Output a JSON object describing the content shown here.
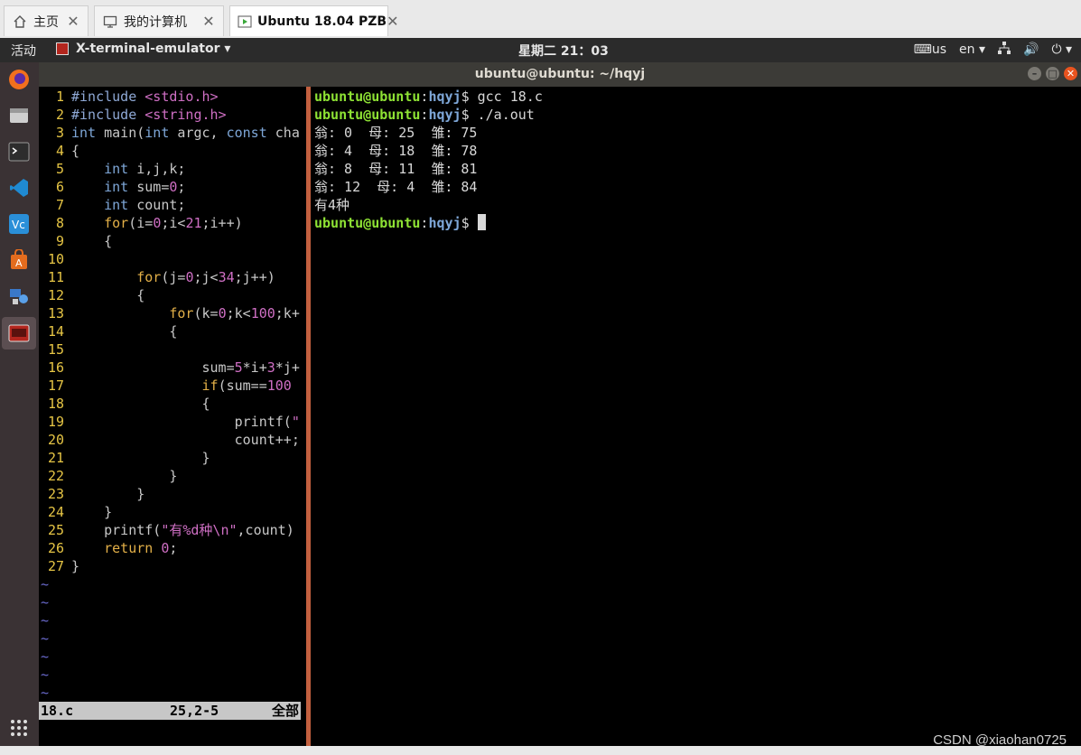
{
  "vm_tabs": [
    {
      "label": "主页",
      "icon": "home-icon"
    },
    {
      "label": "我的计算机",
      "icon": "computer-icon"
    },
    {
      "label": "Ubuntu 18.04 PZB",
      "icon": "vm-play-icon"
    }
  ],
  "topbar": {
    "activities": "活动",
    "app_menu": "X-terminal-emulator ▾",
    "clock": "星期二 21：03",
    "keyboard": "us",
    "language": "en ▾"
  },
  "window": {
    "title": "ubuntu@ubuntu: ~/hqyj"
  },
  "vim": {
    "lines": [
      {
        "n": "1",
        "text": "#include <stdio.h>"
      },
      {
        "n": "2",
        "text": "#include <string.h>"
      },
      {
        "n": "3",
        "text": "int main(int argc, const cha"
      },
      {
        "n": "4",
        "text": "{"
      },
      {
        "n": "5",
        "text": "    int i,j,k;"
      },
      {
        "n": "6",
        "text": "    int sum=0;"
      },
      {
        "n": "7",
        "text": "    int count;"
      },
      {
        "n": "8",
        "text": "    for(i=0;i<21;i++)"
      },
      {
        "n": "9",
        "text": "    {"
      },
      {
        "n": "10",
        "text": ""
      },
      {
        "n": "11",
        "text": "        for(j=0;j<34;j++)"
      },
      {
        "n": "12",
        "text": "        {"
      },
      {
        "n": "13",
        "text": "            for(k=0;k<100;k+"
      },
      {
        "n": "14",
        "text": "            {"
      },
      {
        "n": "15",
        "text": ""
      },
      {
        "n": "16",
        "text": "                sum=5*i+3*j+"
      },
      {
        "n": "17",
        "text": "                if(sum==100"
      },
      {
        "n": "18",
        "text": "                {"
      },
      {
        "n": "19",
        "text": "                    printf(\""
      },
      {
        "n": "20",
        "text": "                    count++;"
      },
      {
        "n": "21",
        "text": "                }"
      },
      {
        "n": "22",
        "text": "            }"
      },
      {
        "n": "23",
        "text": "        }"
      },
      {
        "n": "24",
        "text": "    }"
      },
      {
        "n": "25",
        "text": "    printf(\"有%d种\\n\",count)"
      },
      {
        "n": "26",
        "text": "    return 0;"
      },
      {
        "n": "27",
        "text": "}"
      }
    ],
    "tildes": [
      "~",
      "~",
      "~",
      "~",
      "~",
      "~",
      "~"
    ],
    "status": {
      "file": "18.c",
      "pos": "25,2-5",
      "scope": "全部"
    }
  },
  "shell": {
    "prompt_user": "ubuntu@ubuntu",
    "prompt_dir": "hqyj",
    "prompt_symbol": "$",
    "commands": [
      "gcc 18.c",
      "./a.out"
    ],
    "output": [
      "翁: 0  母: 25  雏: 75",
      "翁: 4  母: 18  雏: 78",
      "翁: 8  母: 11  雏: 81",
      "翁: 12  母: 4  雏: 84",
      "有4种"
    ]
  },
  "watermark": "CSDN @xiaohan0725"
}
